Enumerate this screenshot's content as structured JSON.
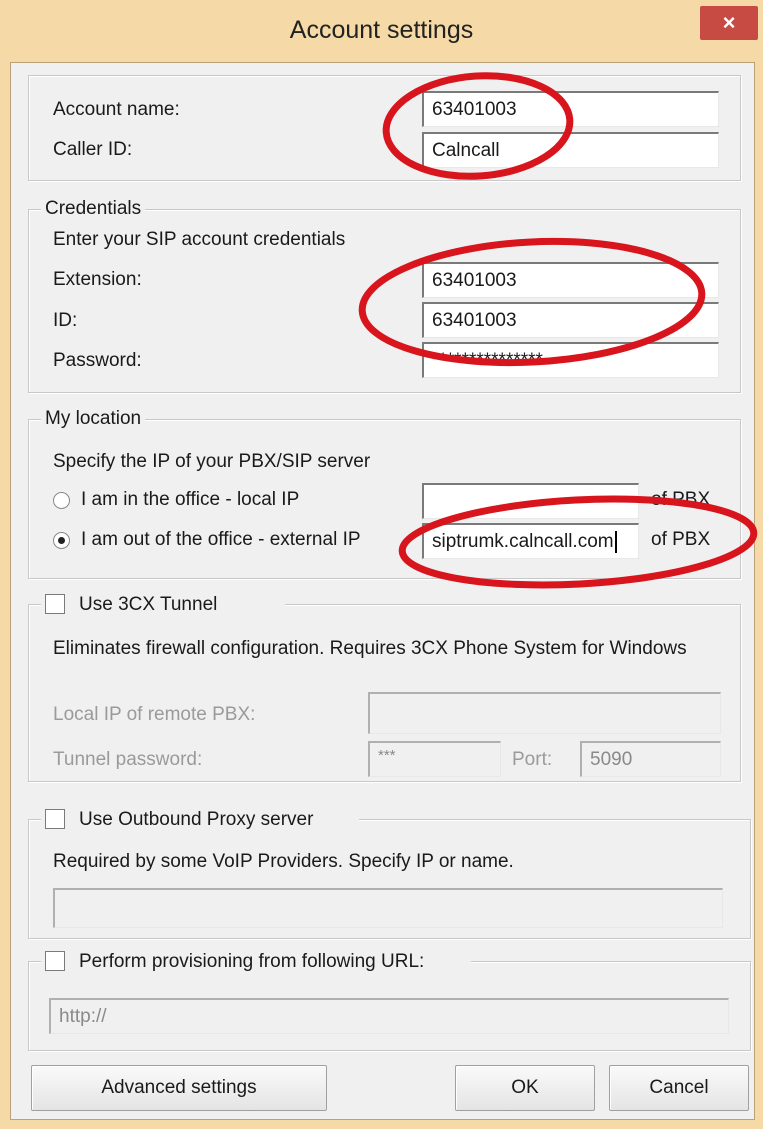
{
  "window": {
    "title": "Account settings",
    "close_glyph": "×"
  },
  "account": {
    "name_label": "Account name:",
    "name_value": "63401003",
    "caller_id_label": "Caller ID:",
    "caller_id_value": "Calncall"
  },
  "credentials": {
    "legend": "Credentials",
    "hint": "Enter your SIP account credentials",
    "extension_label": "Extension:",
    "extension_value": "63401003",
    "id_label": "ID:",
    "id_value": "63401003",
    "password_label": "Password:",
    "password_value": "***************"
  },
  "location": {
    "legend": "My location",
    "hint": "Specify the IP of your PBX/SIP server",
    "local_option": "I am in the office - local IP",
    "local_value": "",
    "local_suffix": "of PBX",
    "external_option": "I am out of the office - external IP",
    "external_value": "siptrumk.calncall.com",
    "external_suffix": "of PBX",
    "selected": "external"
  },
  "tunnel": {
    "checkbox_label": "Use 3CX Tunnel",
    "checked": false,
    "description": "Eliminates firewall configuration. Requires 3CX Phone System for Windows",
    "local_ip_label": "Local IP of remote PBX:",
    "local_ip_value": "",
    "password_label": "Tunnel password:",
    "password_value": "***",
    "port_label": "Port:",
    "port_value": "5090"
  },
  "proxy": {
    "checkbox_label": "Use Outbound Proxy server",
    "checked": false,
    "description": "Required by some VoIP Providers. Specify IP or name.",
    "value": ""
  },
  "provisioning": {
    "checkbox_label": "Perform provisioning from following URL:",
    "checked": false,
    "url_value": "http://"
  },
  "buttons": {
    "advanced": "Advanced settings",
    "ok": "OK",
    "cancel": "Cancel"
  },
  "colors": {
    "frame": "#f5d9a6",
    "close_button": "#c74b43",
    "annotation": "#d8141c"
  }
}
